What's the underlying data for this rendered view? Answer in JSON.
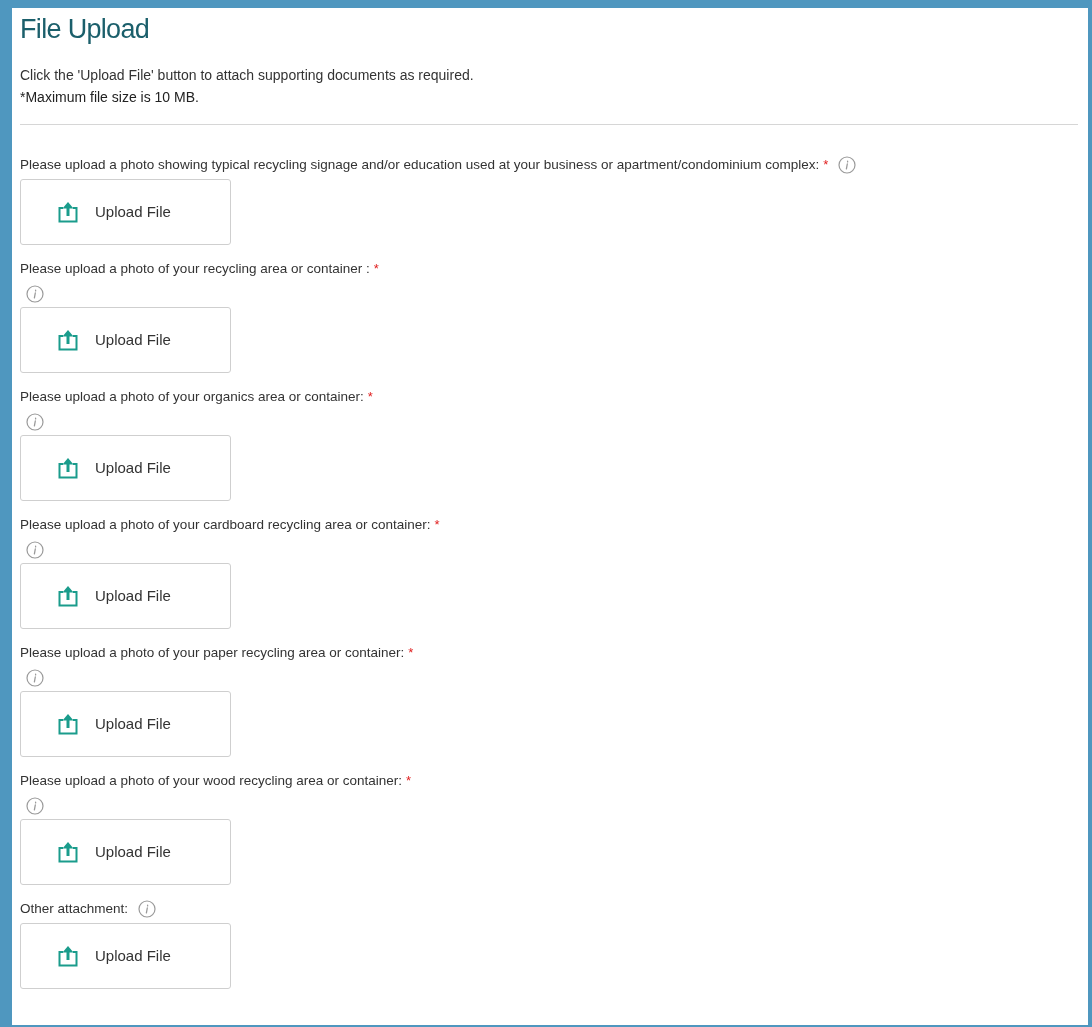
{
  "title": "File Upload",
  "intro": "Click the 'Upload File' button to attach supporting documents as required.",
  "note": "*Maximum file size is 10 MB.",
  "uploads": [
    {
      "kind": "inline",
      "label": "Please upload a photo showing typical recycling signage and/or education used at your business or apartment/condominium complex:",
      "required_mark": "*",
      "button": "Upload File"
    },
    {
      "kind": "stacked",
      "label": "Please upload a photo of your recycling area or container :",
      "required_mark": "*",
      "button": "Upload File"
    },
    {
      "kind": "stacked",
      "label": "Please upload a photo of your organics area or container:",
      "required_mark": "*",
      "button": "Upload File"
    },
    {
      "kind": "stacked",
      "label": "Please upload a photo of your cardboard recycling area or container:",
      "required_mark": "*",
      "button": "Upload File"
    },
    {
      "kind": "stacked",
      "label": "Please upload a photo of your paper recycling area or container:",
      "required_mark": "*",
      "button": "Upload File"
    },
    {
      "kind": "stacked",
      "label": "Please upload a photo of your wood recycling area or container:",
      "required_mark": "*",
      "button": "Upload File"
    },
    {
      "kind": "inline",
      "label": "Other attachment:",
      "button": "Upload File"
    }
  ]
}
